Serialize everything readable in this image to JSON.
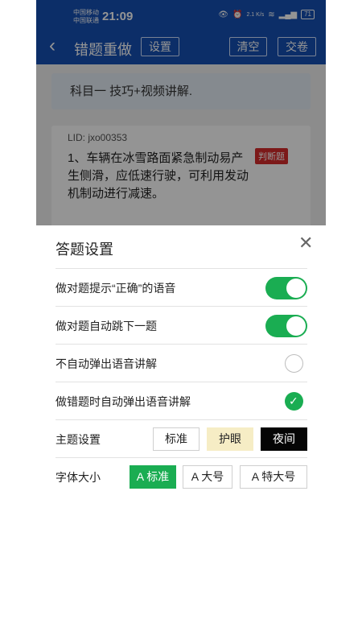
{
  "status_bar": {
    "carrier_1": "中国移动",
    "carrier_2": "中国联通",
    "time": "21:09",
    "speed": "2.1 K/s",
    "battery": "71"
  },
  "navbar": {
    "title": "错题重做",
    "settings_label": "设置",
    "clear_label": "清空",
    "submit_label": "交卷"
  },
  "content": {
    "banner": "科目一 技巧+视频讲解.",
    "question": {
      "lid": "LID: jxo00353",
      "text": "1、车辆在冰雪路面紧急制动易产生侧滑，应低速行驶，可利用发动机制动进行减速。",
      "badge": "判断题"
    }
  },
  "sheet": {
    "title": "答题设置",
    "rows": [
      {
        "label": "做对题提示“正确”的语音",
        "control": "toggle",
        "on": true
      },
      {
        "label": "做对题自动跳下一题",
        "control": "toggle",
        "on": true
      },
      {
        "label": "不自动弹出语音讲解",
        "control": "radio",
        "checked": false
      },
      {
        "label": "做错题时自动弹出语音讲解",
        "control": "radio",
        "checked": true
      }
    ],
    "theme": {
      "label": "主题设置",
      "options": [
        "标准",
        "护眼",
        "夜间"
      ],
      "selected": "夜间"
    },
    "font_size": {
      "label": "字体大小",
      "options": [
        "A 标准",
        "A 大号",
        "A 特大号"
      ],
      "selected": "A 标准"
    }
  },
  "colors": {
    "primary": "#1650b4",
    "accent_green": "#1aad52",
    "badge_red": "#d62b2b",
    "eye_care_bg": "#f6edc5"
  }
}
